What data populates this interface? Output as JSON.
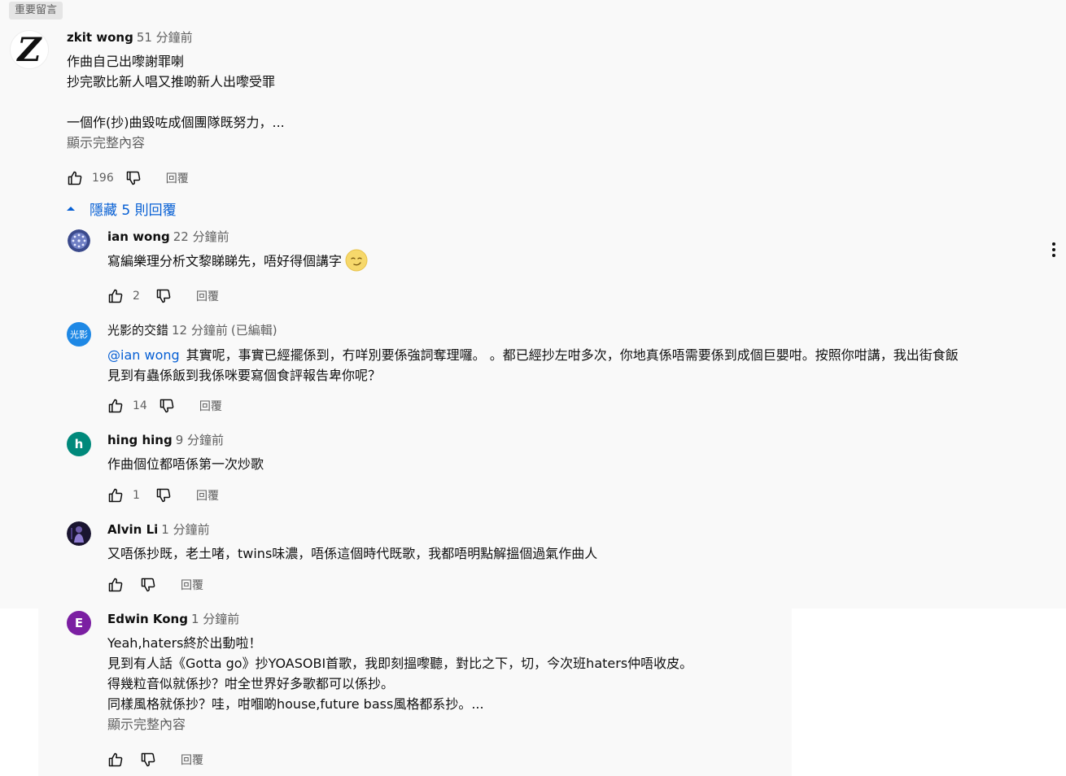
{
  "pinned_label": "重要留言",
  "thread": {
    "author": "zkit wong",
    "time": "51 分鐘前",
    "avatar_letter": "Z",
    "lines": [
      "作曲自己出嚟謝罪喇",
      "抄完歌比新人唱又推啲新人出嚟受罪",
      "",
      "一個作(抄)曲毀咗成個團隊既努力，..."
    ],
    "show_more": "顯示完整內容",
    "likes": "196",
    "reply_label": "回覆",
    "toggle_label": "隱藏 5 則回覆"
  },
  "replies": [
    {
      "author": "ian wong",
      "time": "22 分鐘前",
      "avatar_icon": "globe-avatar-icon",
      "lines": [
        "寫編樂理分析文黎睇睇先，唔好得個講字"
      ],
      "emoji_icon": "smirk-face-emoji-icon",
      "likes": "2",
      "reply_label": "回覆"
    },
    {
      "author": "光影的交錯",
      "time": "12 分鐘前",
      "edited": "(已編輯)",
      "avatar_text": "光影",
      "mention": "@ian wong",
      "lines": [
        "其實呢，事實已經擺係到，冇咩別要係強詞奪理囉。 。都已經抄左咁多次，你地真係唔需要係到成個巨嬰咁。按照你咁講，我出街食飯",
        "見到有蟲係飯到我係咪要寫個食評報告卑你呢？"
      ],
      "likes": "14",
      "reply_label": "回覆"
    },
    {
      "author": "hing hing",
      "time": "9 分鐘前",
      "avatar_letter": "h",
      "lines": [
        "作曲個位都唔係第一次炒歌"
      ],
      "likes": "1",
      "reply_label": "回覆"
    },
    {
      "author": "Alvin Li",
      "time": "1 分鐘前",
      "avatar_icon": "photo-avatar-icon",
      "lines": [
        "又唔係抄既，老土啫，twins味濃，唔係這個時代既歌，我都唔明點解搵個過氣作曲人"
      ],
      "likes": "",
      "reply_label": "回覆"
    },
    {
      "author": "Edwin Kong",
      "time": "1 分鐘前",
      "avatar_letter": "E",
      "lines": [
        "Yeah,haters終於出動啦！",
        "見到有人話《Gotta go》抄YOASOBI首歌，我即刻搵嚟聽，對比之下，切，今次班haters仲唔收皮。",
        "得幾粒音似就係抄？咁全世界好多歌都可以係抄。",
        "同樣風格就係抄？哇，咁嗰啲house,future bass風格都系抄。..."
      ],
      "show_more": "顯示完整內容",
      "likes": "",
      "reply_label": "回覆"
    }
  ],
  "colors": {
    "link_blue": "#065fd4",
    "secondary_text": "#606060",
    "avatar_ying": "#1e88e5",
    "avatar_h": "#00897b",
    "avatar_e": "#7b1fa2"
  }
}
